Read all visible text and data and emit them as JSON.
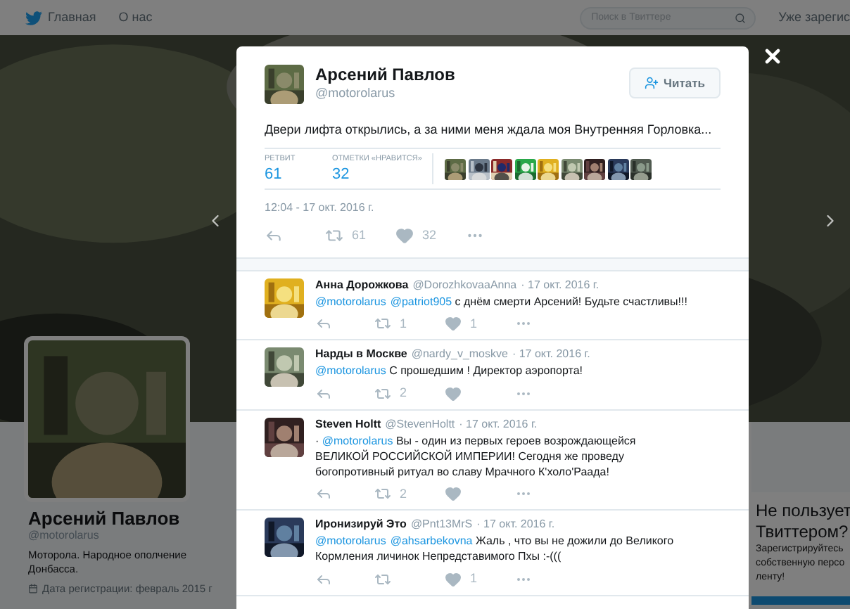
{
  "top_nav": {
    "items": [
      {
        "label": "Главная",
        "kind": "home"
      },
      {
        "label": "О нас",
        "kind": "plain"
      }
    ],
    "search": {
      "placeholder": "Поиск в Твиттере"
    },
    "login_text": "Уже зарегис"
  },
  "profile": {
    "name": "Арсений Павлов",
    "handle": "@motorolarus",
    "bio": "Моторола. Народное ополчение Донбасса.",
    "joined": "Дата регистрации: февраль 2015 г"
  },
  "signup_panel": {
    "title_lines": [
      "Не пользует",
      "Твиттером?"
    ],
    "text_lines": [
      "Зарегистрируйтесь",
      "собственную персо",
      "ленту!"
    ]
  },
  "tweet_modal": {
    "author": {
      "name": "Арсений Павлов",
      "handle": "@motorolarus"
    },
    "follow_button": "Читать",
    "text": "Двери лифта открылись, а за ними меня ждала моя Внутренняя Горловка...",
    "stats": [
      {
        "label": "РЕТВИТ",
        "value": "61"
      },
      {
        "label": "ОТМЕТКИ «НРАВИТСЯ»",
        "value": "32"
      }
    ],
    "timestamp": "12:04 - 17 окт. 2016 г.",
    "retweets": "61",
    "likes": "32"
  },
  "replies": [
    {
      "name": "Анна Дорожкова",
      "handle": "@DorozhkovaaAnna",
      "date": "· 17 окт. 2016 г.",
      "text": [
        {
          "kind": "mention",
          "text": "@motorolarus"
        },
        {
          "kind": "mention",
          "text": "@patriot905"
        },
        {
          "kind": "text",
          "text": " с днём смерти Арсений! Будьте счастливы!!!"
        }
      ],
      "retweets": "1",
      "likes": "1"
    },
    {
      "name": "Нарды в Москве",
      "handle": "@nardy_v_moskve",
      "date": "· 17 окт. 2016 г.",
      "text": [
        {
          "kind": "mention",
          "text": "@motorolarus"
        },
        {
          "kind": "text",
          "text": " С прошедшим ! Директор аэропорта!"
        }
      ],
      "retweets": "2"
    },
    {
      "name": "Steven Holtt",
      "handle": "@StevenHoltt",
      "date": "· 17 окт. 2016 г.",
      "text": [
        {
          "kind": "text",
          "text": "· "
        },
        {
          "kind": "mention",
          "text": "@motorolarus"
        },
        {
          "kind": "text",
          "text": " Вы - один из первых героев возрождающейся ВЕЛИКОЙ РОССИЙСКОЙ ИМПЕРИИ! Сегодня же проведу богопротивный ритуал во славу Мрачного К'холо'Раада!"
        }
      ],
      "retweets": "2"
    },
    {
      "name": "Иронизируй Это",
      "handle": "@Pnt13MrS",
      "date": "· 17 окт. 2016 г.",
      "text": [
        {
          "kind": "mention",
          "text": "@motorolarus"
        },
        {
          "kind": "mention",
          "text": "@ahsarbekovna"
        },
        {
          "kind": "text",
          "text": " Жаль , что вы не дожили до Великого Кормления личинок Непредставимого Пхы  :-((("
        }
      ],
      "likes": "1"
    }
  ]
}
